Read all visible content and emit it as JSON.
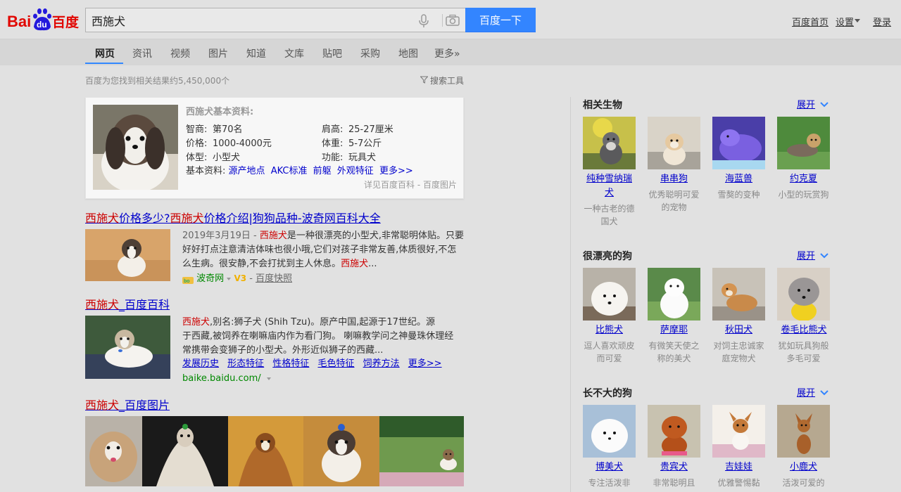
{
  "header": {
    "logo_bai": "Bai",
    "logo_du": "du",
    "logo_cn": "百度",
    "search_value": "西施犬",
    "search_button": "百度一下",
    "links": {
      "home": "百度首页",
      "settings": "设置",
      "login": "登录"
    }
  },
  "tabs": [
    "网页",
    "资讯",
    "视频",
    "图片",
    "知道",
    "文库",
    "贴吧",
    "采购",
    "地图",
    "更多»"
  ],
  "stats": {
    "result_count": "百度为您找到相关结果约5,450,000个",
    "search_tools": "搜索工具"
  },
  "info_card": {
    "title": "西施犬基本资料:",
    "fields": [
      {
        "k": "智商:",
        "v": "第70名"
      },
      {
        "k": "肩高:",
        "v": "25-27厘米"
      },
      {
        "k": "价格:",
        "v": "1000-4000元"
      },
      {
        "k": "体重:",
        "v": "5-7公斤"
      },
      {
        "k": "体型:",
        "v": "小型犬"
      },
      {
        "k": "功能:",
        "v": "玩具犬"
      }
    ],
    "links_label": "基本资料:",
    "links": [
      "源产地点",
      "AKC标准",
      "前躯",
      "外观特征",
      "更多>>"
    ],
    "source": "详见百度百科 - 百度图片"
  },
  "results": [
    {
      "title_parts": [
        "西施犬",
        "价格多少?",
        "西施犬",
        "价格介绍|狗狗品种-波奇网百科大全"
      ],
      "date": "2019年3月19日 - ",
      "snippet_lines": [
        [
          "西施犬",
          "是一种很漂亮的小型犬,非常聪明体贴。只要"
        ],
        [
          "",
          "好好打点注意清洁体味也很小哦,它们对孩子非常友善,体质很好,不怎"
        ],
        [
          "",
          "么生病。很安静,不会打扰到主人休息。"
        ],
        [
          "西施犬",
          "..."
        ]
      ],
      "site": "波奇网",
      "v_badge": "V3",
      "snapshot": "百度快照"
    },
    {
      "title_parts": [
        "西施犬",
        "_百度百科"
      ],
      "snippet_lines": [
        [
          "西施犬",
          ",别名:狮子犬 (Shih Tzu)。原产中国,起源于17世纪。源"
        ],
        [
          "",
          "于西藏,被饲养在喇嘛庙内作为看门狗。 喇嘛教学问之神曼珠休理经"
        ],
        [
          "",
          "常携带会变狮子的小型犬。外形近似狮子的西藏..."
        ]
      ],
      "sublinks": [
        "发展历史",
        "形态特征",
        "性格特征",
        "毛色特征",
        "饲养方法",
        "更多>>"
      ],
      "url": "baike.baidu.com/"
    },
    {
      "title_parts": [
        "西施犬",
        "_百度图片"
      ]
    }
  ],
  "right_panel": {
    "expand_label": "展开",
    "sections": [
      {
        "heading": "相关生物",
        "items": [
          {
            "name": "纯种雪纳瑞犬",
            "desc": "一种古老的德国犬"
          },
          {
            "name": "串串狗",
            "desc": "优秀聪明可爱的宠物"
          },
          {
            "name": "海蓝兽",
            "desc": "雪獒的变种"
          },
          {
            "name": "约克夏",
            "desc": "小型的玩赏狗"
          }
        ]
      },
      {
        "heading": "很漂亮的狗",
        "items": [
          {
            "name": "比熊犬",
            "desc": "逗人喜欢顽皮而可爱"
          },
          {
            "name": "萨摩耶",
            "desc": "有微笑天使之称的美犬"
          },
          {
            "name": "秋田犬",
            "desc": "对饲主忠诚家庭宠物犬"
          },
          {
            "name": "卷毛比熊犬",
            "desc": "犹如玩具狗般多毛可爱"
          }
        ]
      },
      {
        "heading": "长不大的狗",
        "items": [
          {
            "name": "博美犬",
            "desc": "专注活泼非"
          },
          {
            "name": "贵宾犬",
            "desc": "非常聪明且"
          },
          {
            "name": "吉娃娃",
            "desc": "优雅警惕黏"
          },
          {
            "name": "小鹿犬",
            "desc": "活泼可爱的"
          }
        ]
      }
    ]
  },
  "colors": {
    "accent": "#3385ff",
    "link": "#0000cc",
    "highlight": "#cc0000",
    "url_green": "#008000"
  }
}
